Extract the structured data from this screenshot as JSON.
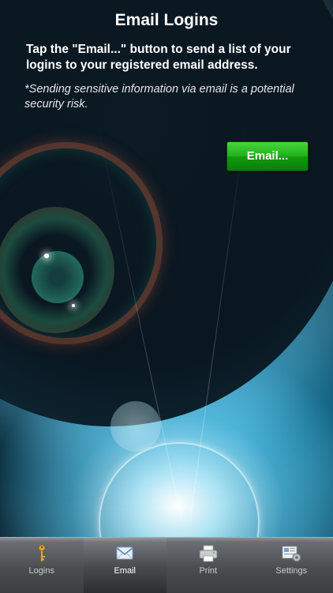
{
  "header": {
    "title": "Email Logins"
  },
  "main": {
    "instructions": "Tap the \"Email...\" button to send a list of your logins to your registered email address.",
    "warning": "*Sending sensitive information via email is a potential security risk.",
    "email_button_label": "Email..."
  },
  "tabbar": {
    "active": "Email",
    "tabs": [
      {
        "label": "Logins",
        "icon": "key-icon"
      },
      {
        "label": "Email",
        "icon": "envelope-icon"
      },
      {
        "label": "Print",
        "icon": "printer-icon"
      },
      {
        "label": "Settings",
        "icon": "settings-icon"
      }
    ]
  },
  "colors": {
    "button": "#22b11c",
    "tabbar": "#4b4e51",
    "text": "#ffffff"
  }
}
